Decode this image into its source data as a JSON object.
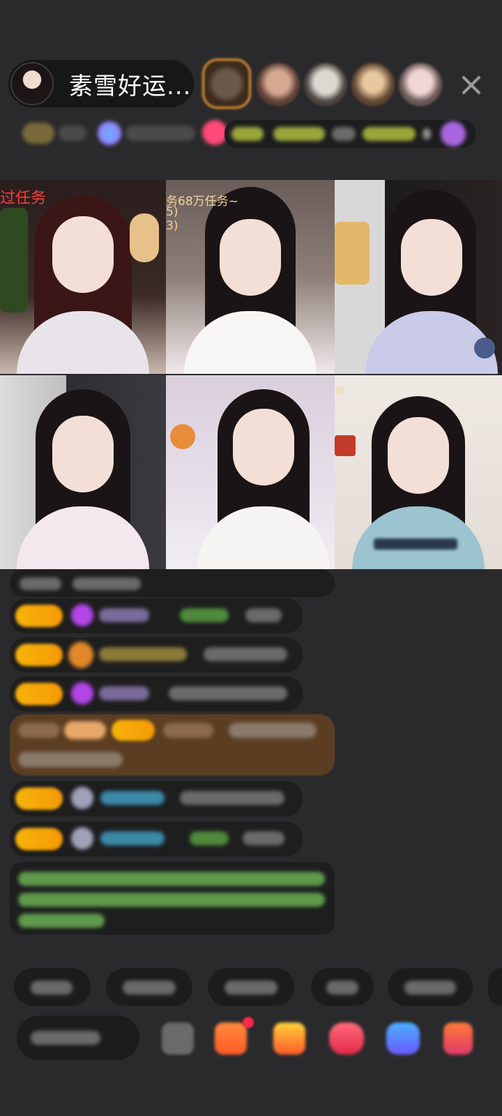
{
  "header": {
    "host_name": "素雪好运...",
    "close_icon": "close-icon"
  },
  "video_tiles": [
    {
      "label": "过任务",
      "label_color": "#ff3a3a"
    },
    {
      "label": "务68万任务~",
      "sub1": "5)",
      "sub2": "3)",
      "label_color": "#f2d39a"
    },
    {
      "label": "",
      "label_color": "#ffffff"
    },
    {
      "label": "",
      "label_color": "#ffffff"
    },
    {
      "label": "",
      "label_color": "#ffffff"
    },
    {
      "label": "榜",
      "label_color": "#f2d39a"
    }
  ],
  "colors": {
    "background": "#2a2a2c",
    "badge_orange": "#f7a90a",
    "gift_panel": "#5b3e22"
  }
}
